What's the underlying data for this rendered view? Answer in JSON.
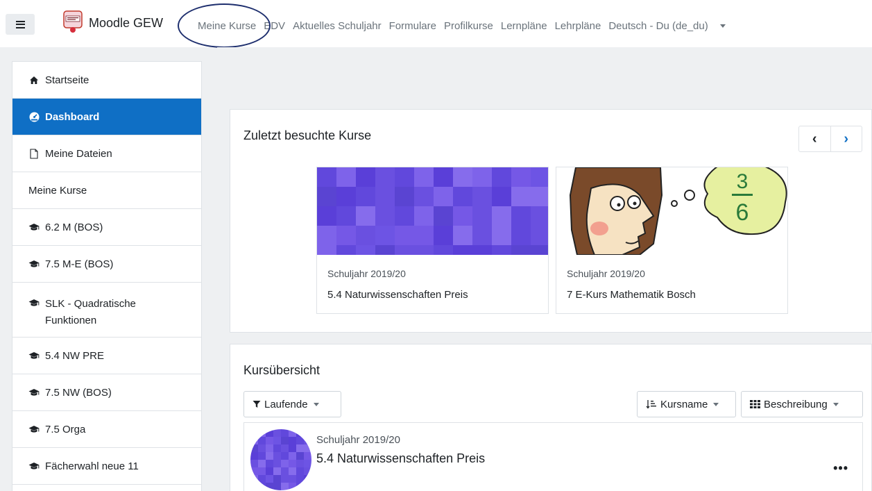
{
  "navbar": {
    "brand": "Moodle GEW",
    "links": [
      "Meine Kurse",
      "EDV",
      "Aktuelles Schuljahr",
      "Formulare",
      "Profilkurse",
      "Lernpläne",
      "Lehrpläne"
    ],
    "language": "Deutsch - Du (de_du)"
  },
  "sidebar": {
    "items": [
      {
        "label": "Startseite",
        "icon": "home-icon"
      },
      {
        "label": "Dashboard",
        "icon": "dashboard-icon",
        "active": true
      },
      {
        "label": "Meine Dateien",
        "icon": "file-icon"
      },
      {
        "label": "Meine Kurse"
      },
      {
        "label": "6.2 M (BOS)",
        "icon": "graduation-cap-icon"
      },
      {
        "label": "7.5 M-E (BOS)",
        "icon": "graduation-cap-icon"
      },
      {
        "label": "SLK - Quadratische",
        "label2": "Funktionen",
        "icon": "graduation-cap-icon"
      },
      {
        "label": "5.4 NW PRE",
        "icon": "graduation-cap-icon"
      },
      {
        "label": "7.5 NW (BOS)",
        "icon": "graduation-cap-icon"
      },
      {
        "label": "7.5 Orga",
        "icon": "graduation-cap-icon"
      },
      {
        "label": "Fächerwahl neue 11",
        "icon": "graduation-cap-icon"
      }
    ]
  },
  "recent": {
    "title": "Zuletzt besuchte Kurse",
    "prev": "‹",
    "next": "›",
    "courses": [
      {
        "category": "Schuljahr 2019/20",
        "name": "5.4 Naturwissenschaften Preis"
      },
      {
        "category": "Schuljahr 2019/20",
        "name": "7 E-Kurs Mathematik Bosch"
      }
    ]
  },
  "overview": {
    "title": "Kursübersicht",
    "filter": "Laufende",
    "sort": "Kursname",
    "view": "Beschreibung",
    "course": {
      "category": "Schuljahr 2019/20",
      "name": "5.4 Naturwissenschaften Preis",
      "menu": "•••"
    }
  },
  "colors": {
    "accent": "#0f6fc5",
    "tile_purple": "#6a50e0"
  }
}
